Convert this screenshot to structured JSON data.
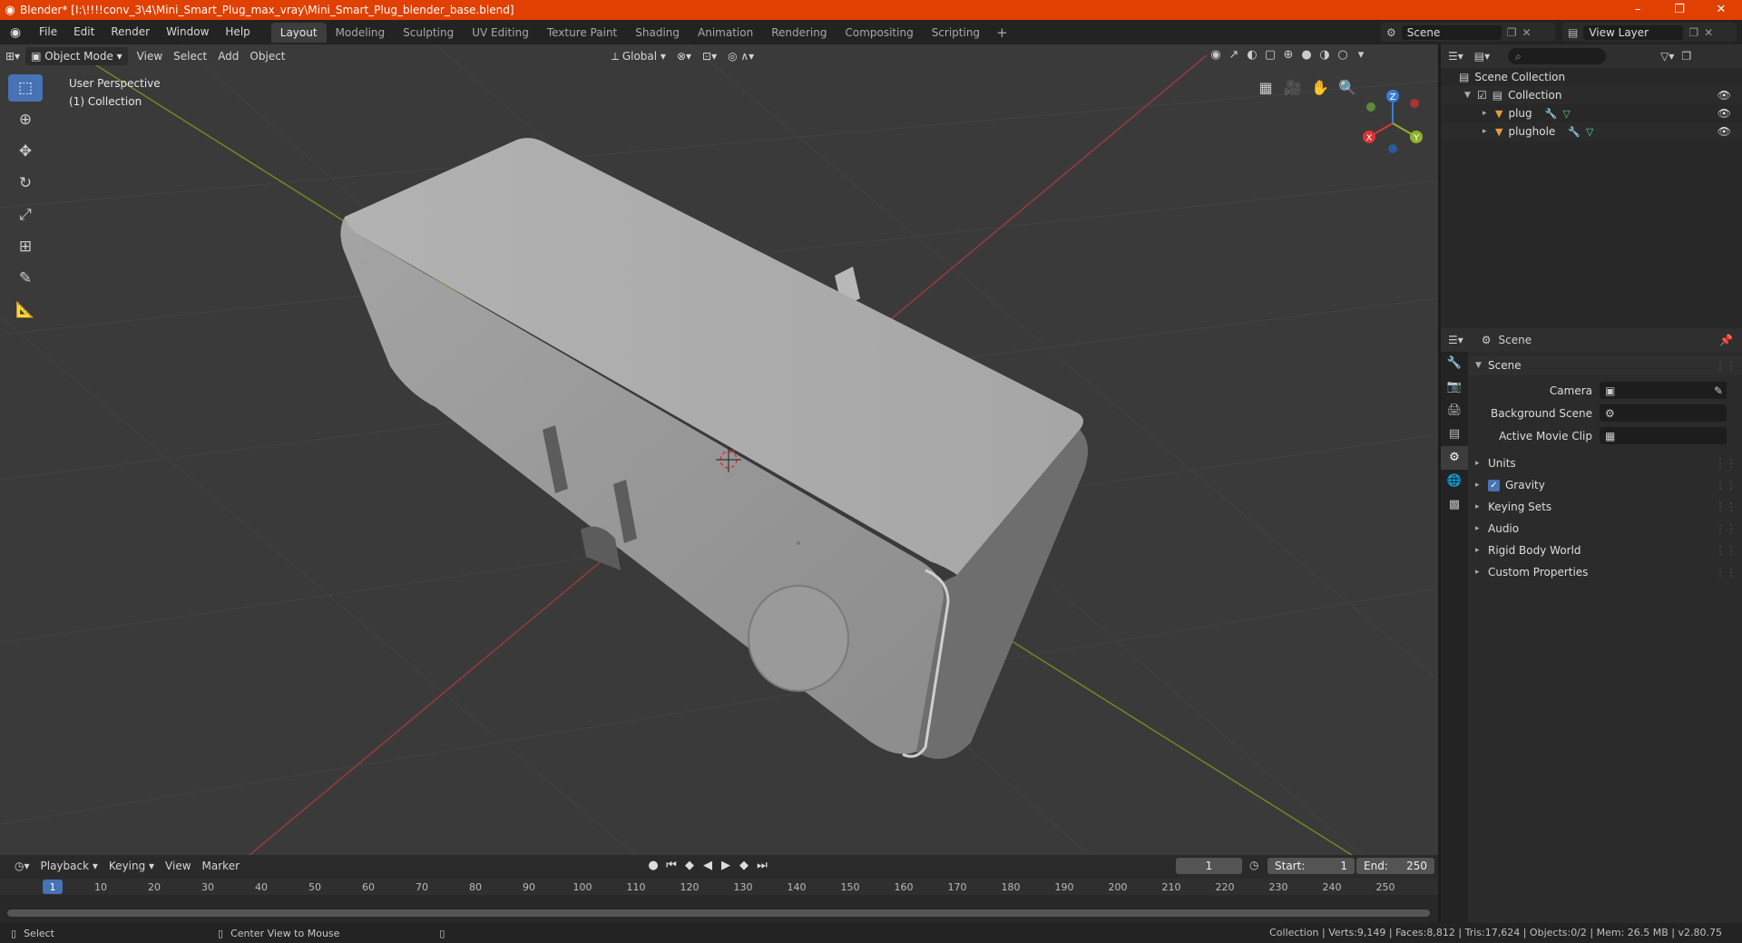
{
  "window": {
    "title": "Blender* [I:\\!!!!conv_3\\4\\Mini_Smart_Plug_max_vray\\Mini_Smart_Plug_blender_base.blend]",
    "minimize": "–",
    "maximize": "❐",
    "close": "✕"
  },
  "menu": [
    "File",
    "Edit",
    "Render",
    "Window",
    "Help"
  ],
  "workspaces": [
    "Layout",
    "Modeling",
    "Sculpting",
    "UV Editing",
    "Texture Paint",
    "Shading",
    "Animation",
    "Rendering",
    "Compositing",
    "Scripting"
  ],
  "active_workspace": "Layout",
  "scene_selector": "Scene",
  "view_layer_selector": "View Layer",
  "viewport": {
    "mode": "Object Mode",
    "menus": [
      "View",
      "Select",
      "Add",
      "Object"
    ],
    "orientation": "Global",
    "info_line1": "User Perspective",
    "info_line2": "(1) Collection",
    "gizmo": {
      "x": "X",
      "y": "Y",
      "z": "Z"
    },
    "colors": {
      "x_axis": "#9a3a3a",
      "y_axis": "#6c8a22",
      "background": "#3a3a3a",
      "grid": "#444444"
    }
  },
  "timeline": {
    "menus": [
      "Playback",
      "Keying",
      "View",
      "Marker"
    ],
    "current_frame": "1",
    "start_label": "Start:",
    "start": "1",
    "end_label": "End:",
    "end": "250",
    "ruler": [
      "1",
      "10",
      "20",
      "30",
      "40",
      "50",
      "60",
      "70",
      "80",
      "90",
      "100",
      "110",
      "120",
      "130",
      "140",
      "150",
      "160",
      "170",
      "180",
      "190",
      "200",
      "210",
      "220",
      "230",
      "240",
      "250"
    ]
  },
  "statusbar": {
    "select": "Select",
    "center": "Center View to Mouse",
    "stats": "Collection | Verts:9,149 | Faces:8,812 | Tris:17,624 | Objects:0/2 | Mem: 26.5 MB | v2.80.75"
  },
  "outliner": {
    "scene_collection": "Scene Collection",
    "collection": "Collection",
    "objects": [
      "plug",
      "plughole"
    ]
  },
  "properties": {
    "header": "Scene",
    "panel": "Scene",
    "camera_label": "Camera",
    "background_scene_label": "Background Scene",
    "active_movie_clip_label": "Active Movie Clip",
    "subpanels": [
      "Units",
      "Gravity",
      "Keying Sets",
      "Audio",
      "Rigid Body World",
      "Custom Properties"
    ]
  },
  "accent": "#4772b3",
  "title_bar_color": "#e04000"
}
